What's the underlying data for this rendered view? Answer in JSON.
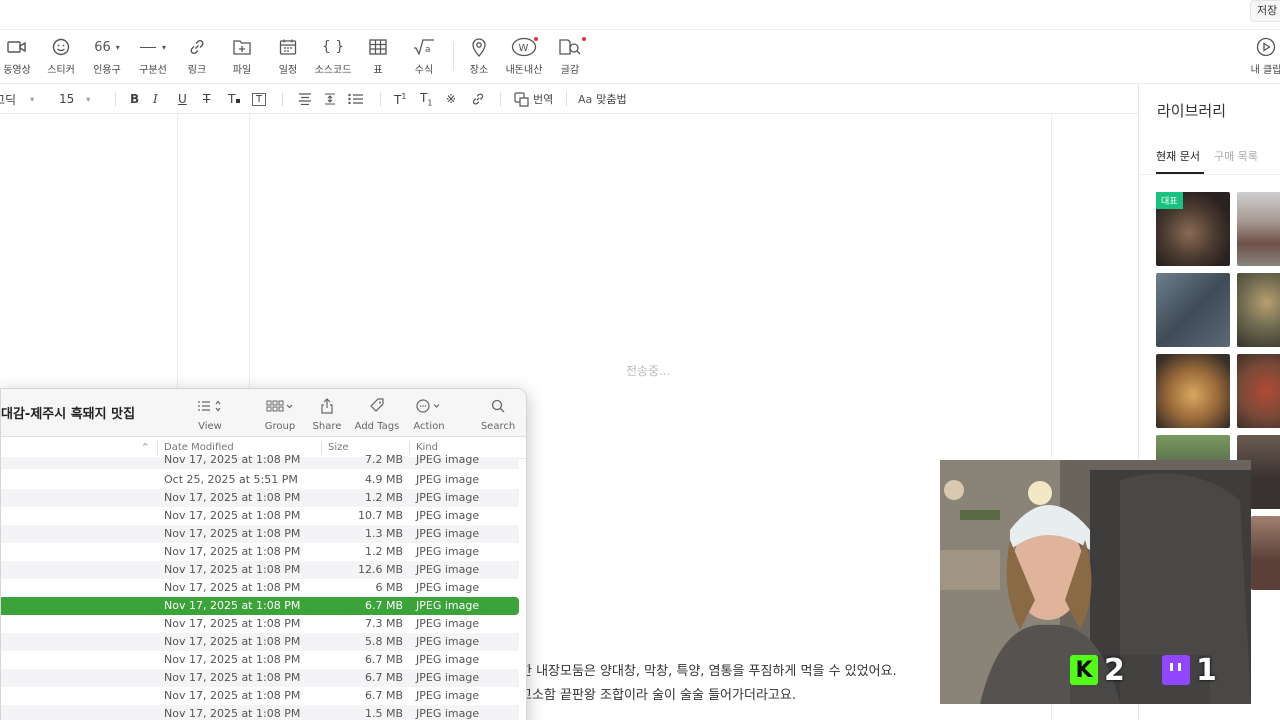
{
  "topbar": {
    "save_label": "저장"
  },
  "insert_toolbar": {
    "items": [
      {
        "label": "동영상",
        "icon": "video-icon"
      },
      {
        "label": "스티커",
        "icon": "sticker-icon"
      },
      {
        "label": "인용구",
        "icon": "quote-icon"
      },
      {
        "label": "구분선",
        "icon": "divider-icon"
      },
      {
        "label": "링크",
        "icon": "link-icon"
      },
      {
        "label": "파일",
        "icon": "file-icon"
      },
      {
        "label": "일정",
        "icon": "calendar-icon"
      },
      {
        "label": "소스코드",
        "icon": "code-icon"
      },
      {
        "label": "표",
        "icon": "table-icon"
      },
      {
        "label": "수식",
        "icon": "formula-icon"
      },
      {
        "label": "장소",
        "icon": "place-icon"
      },
      {
        "label": "내돈내산",
        "icon": "my-money-icon"
      },
      {
        "label": "글감",
        "icon": "material-icon"
      },
      {
        "label": "내 클립",
        "icon": "clip-icon"
      }
    ]
  },
  "format_toolbar": {
    "font_name": "고딕",
    "font_size": "15",
    "translate_label": "번역",
    "spellcheck_label": "맞춤법"
  },
  "editor": {
    "sending_text": "전송중...",
    "line1": "한 내장모둠은 양대창, 막창, 특양, 염통을 푸짐하게 먹을 수 있었어요.",
    "line2": "고소함 끝판왕 조합이라 술이 술술 들어가더라고요."
  },
  "library": {
    "title": "라이브러리",
    "tab_current": "현재 문서",
    "tab_purchase": "구매 목록",
    "badge_label": "대표"
  },
  "finder": {
    "title": "대감-제주시 흑돼지 맛집",
    "toolbar": [
      {
        "label": "View",
        "icon": "list-view-icon"
      },
      {
        "label": "Group",
        "icon": "group-icon"
      },
      {
        "label": "Share",
        "icon": "share-icon"
      },
      {
        "label": "Add Tags",
        "icon": "tag-icon"
      },
      {
        "label": "Action",
        "icon": "action-icon"
      },
      {
        "label": "Search",
        "icon": "search-icon"
      }
    ],
    "columns": {
      "date": "Date Modified",
      "size": "Size",
      "kind": "Kind"
    },
    "rows": [
      {
        "date": "Nov 17, 2025 at 1:08 PM",
        "size": "7.2 MB",
        "kind": "JPEG image"
      },
      {
        "date": "Oct 25, 2025 at 5:51 PM",
        "size": "4.9 MB",
        "kind": "JPEG image"
      },
      {
        "date": "Nov 17, 2025 at 1:08 PM",
        "size": "1.2 MB",
        "kind": "JPEG image"
      },
      {
        "date": "Nov 17, 2025 at 1:08 PM",
        "size": "10.7 MB",
        "kind": "JPEG image"
      },
      {
        "date": "Nov 17, 2025 at 1:08 PM",
        "size": "1.3 MB",
        "kind": "JPEG image"
      },
      {
        "date": "Nov 17, 2025 at 1:08 PM",
        "size": "1.2 MB",
        "kind": "JPEG image"
      },
      {
        "date": "Nov 17, 2025 at 1:08 PM",
        "size": "12.6 MB",
        "kind": "JPEG image"
      },
      {
        "date": "Nov 17, 2025 at 1:08 PM",
        "size": "6 MB",
        "kind": "JPEG image"
      },
      {
        "date": "Nov 17, 2025 at 1:08 PM",
        "size": "6.7 MB",
        "kind": "JPEG image",
        "selected": true
      },
      {
        "date": "Nov 17, 2025 at 1:08 PM",
        "size": "7.3 MB",
        "kind": "JPEG image"
      },
      {
        "date": "Nov 17, 2025 at 1:08 PM",
        "size": "5.8 MB",
        "kind": "JPEG image"
      },
      {
        "date": "Nov 17, 2025 at 1:08 PM",
        "size": "6.7 MB",
        "kind": "JPEG image"
      },
      {
        "date": "Nov 17, 2025 at 1:08 PM",
        "size": "6.7 MB",
        "kind": "JPEG image"
      },
      {
        "date": "Nov 17, 2025 at 1:08 PM",
        "size": "6.7 MB",
        "kind": "JPEG image"
      },
      {
        "date": "Nov 17, 2025 at 1:08 PM",
        "size": "1.5 MB",
        "kind": "JPEG image"
      }
    ]
  },
  "stream_overlay": {
    "kick_count": "2",
    "twitch_count": "1",
    "kick_color": "#53fc18",
    "twitch_color": "#9146ff"
  },
  "colors": {
    "selection": "#3ca33a",
    "library_badge": "#19c37d"
  }
}
